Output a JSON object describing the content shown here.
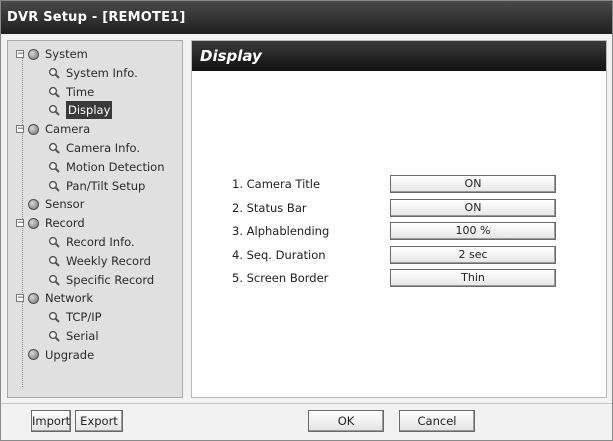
{
  "window": {
    "title": "DVR Setup - [REMOTE1]"
  },
  "tree": {
    "items": [
      {
        "label": "System",
        "level": 0,
        "type": "folder",
        "expander": "−"
      },
      {
        "label": "System Info.",
        "level": 1,
        "type": "page"
      },
      {
        "label": "Time",
        "level": 1,
        "type": "page"
      },
      {
        "label": "Display",
        "level": 1,
        "type": "page",
        "selected": true
      },
      {
        "label": "Camera",
        "level": 0,
        "type": "folder",
        "expander": "−"
      },
      {
        "label": "Camera Info.",
        "level": 1,
        "type": "page"
      },
      {
        "label": "Motion Detection",
        "level": 1,
        "type": "page"
      },
      {
        "label": "Pan/Tilt Setup",
        "level": 1,
        "type": "page"
      },
      {
        "label": "Sensor",
        "level": 0,
        "type": "folder",
        "expander": ""
      },
      {
        "label": "Record",
        "level": 0,
        "type": "folder",
        "expander": "−"
      },
      {
        "label": "Record Info.",
        "level": 1,
        "type": "page"
      },
      {
        "label": "Weekly Record",
        "level": 1,
        "type": "page"
      },
      {
        "label": "Specific Record",
        "level": 1,
        "type": "page"
      },
      {
        "label": "Network",
        "level": 0,
        "type": "folder",
        "expander": "−"
      },
      {
        "label": "TCP/IP",
        "level": 1,
        "type": "page"
      },
      {
        "label": "Serial",
        "level": 1,
        "type": "page"
      },
      {
        "label": "Upgrade",
        "level": 0,
        "type": "folder",
        "expander": ""
      }
    ]
  },
  "panel": {
    "title": "Display",
    "settings": [
      {
        "label": "1. Camera Title",
        "value": "ON"
      },
      {
        "label": "2. Status Bar",
        "value": "ON"
      },
      {
        "label": "3. Alphablending",
        "value": "100 %"
      },
      {
        "label": "4. Seq. Duration",
        "value": "2 sec"
      },
      {
        "label": "5. Screen Border",
        "value": "Thin"
      }
    ]
  },
  "buttons": {
    "import": "Import",
    "export": "Export",
    "ok": "OK",
    "cancel": "Cancel"
  },
  "icons": {
    "folder": "folder-ball-icon",
    "page": "magnifier-icon"
  }
}
